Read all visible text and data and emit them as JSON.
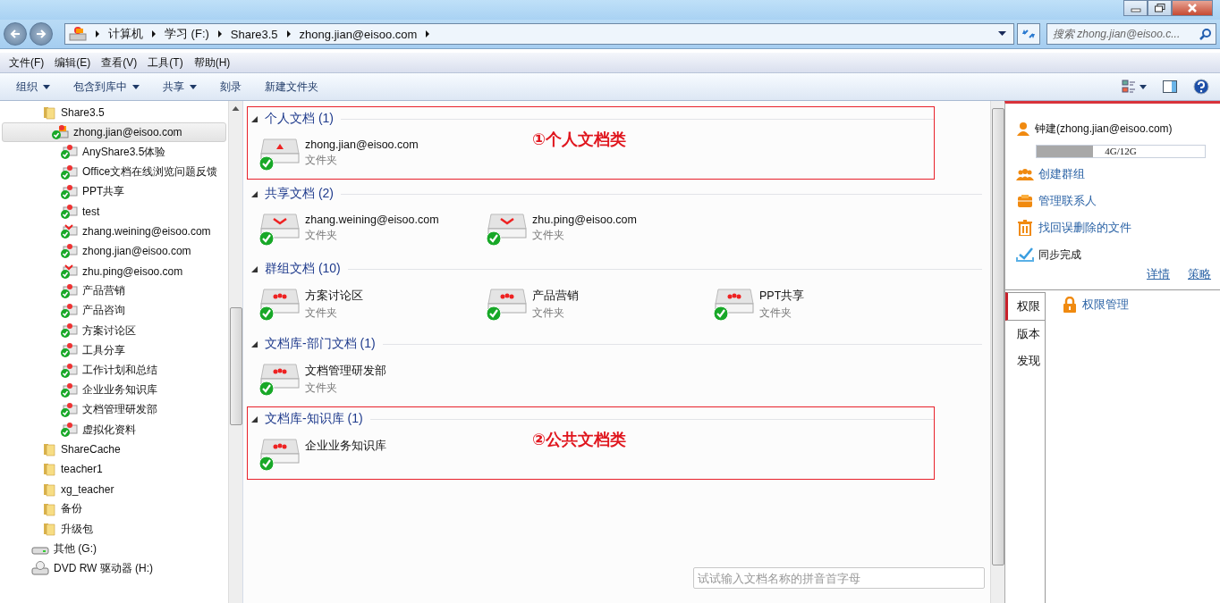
{
  "address_bar": {
    "crumbs": [
      "计算机",
      "学习 (F:)",
      "Share3.5",
      "zhong.jian@eisoo.com"
    ],
    "search": {
      "placeholder": "搜索 zhong.jian@eisoo.c..."
    }
  },
  "menu": [
    "文件(F)",
    "编辑(E)",
    "查看(V)",
    "工具(T)",
    "帮助(H)"
  ],
  "toolbar": [
    {
      "label": "组织",
      "dropdown": true
    },
    {
      "label": "包含到库中",
      "dropdown": true
    },
    {
      "label": "共享",
      "dropdown": true
    },
    {
      "label": "刻录",
      "dropdown": false
    },
    {
      "label": "新建文件夹",
      "dropdown": false
    }
  ],
  "sidebar": {
    "items": [
      {
        "label": "Share3.5",
        "kind": "folder",
        "selected": false,
        "children": [
          {
            "label": "zhong.jian@eisoo.com",
            "kind": "share-root",
            "selected": true,
            "children": [
              {
                "label": "AnyShare3.5体验",
                "kind": "group",
                "selected": false
              },
              {
                "label": "Office文档在线浏览问题反馈",
                "kind": "group",
                "selected": false
              },
              {
                "label": "PPT共享",
                "kind": "group",
                "selected": false
              },
              {
                "label": "test",
                "kind": "group",
                "selected": false
              },
              {
                "label": "zhang.weining@eisoo.com",
                "kind": "shared",
                "selected": false
              },
              {
                "label": "zhong.jian@eisoo.com",
                "kind": "personal",
                "selected": false
              },
              {
                "label": "zhu.ping@eisoo.com",
                "kind": "shared",
                "selected": false
              },
              {
                "label": "产品营销",
                "kind": "group",
                "selected": false
              },
              {
                "label": "产品咨询",
                "kind": "group",
                "selected": false
              },
              {
                "label": "方案讨论区",
                "kind": "group",
                "selected": false
              },
              {
                "label": "工具分享",
                "kind": "group",
                "selected": false
              },
              {
                "label": "工作计划和总结",
                "kind": "group",
                "selected": false
              },
              {
                "label": "企业业务知识库",
                "kind": "group",
                "selected": false
              },
              {
                "label": "文档管理研发部",
                "kind": "group",
                "selected": false
              },
              {
                "label": "虚拟化资料",
                "kind": "group",
                "selected": false
              }
            ]
          }
        ]
      },
      {
        "label": "ShareCache",
        "kind": "folder",
        "selected": false
      },
      {
        "label": "teacher1",
        "kind": "folder",
        "selected": false
      },
      {
        "label": "xg_teacher",
        "kind": "folder",
        "selected": false
      },
      {
        "label": "备份",
        "kind": "folder",
        "selected": false
      },
      {
        "label": "升级包",
        "kind": "folder",
        "selected": false
      },
      {
        "label": "其他 (G:)",
        "kind": "drive",
        "selected": false
      },
      {
        "label": "DVD RW 驱动器 (H:)",
        "kind": "dvd",
        "selected": false
      }
    ]
  },
  "groups": [
    {
      "title": "个人文档 (1)",
      "annotation": "①个人文档类",
      "items": [
        {
          "name": "zhong.jian@eisoo.com",
          "type": "文件夹",
          "kind": "personal"
        }
      ]
    },
    {
      "title": "共享文档 (2)",
      "items": [
        {
          "name": "zhang.weining@eisoo.com",
          "type": "文件夹",
          "kind": "shared"
        },
        {
          "name": "zhu.ping@eisoo.com",
          "type": "文件夹",
          "kind": "shared"
        }
      ]
    },
    {
      "title": "群组文档 (10)",
      "items": [
        {
          "name": "方案讨论区",
          "type": "文件夹",
          "kind": "group"
        },
        {
          "name": "产品营销",
          "type": "文件夹",
          "kind": "group"
        },
        {
          "name": "PPT共享",
          "type": "文件夹",
          "kind": "group"
        }
      ]
    },
    {
      "title": "文档库-部门文档 (1)",
      "items": [
        {
          "name": "文档管理研发部",
          "type": "文件夹",
          "kind": "group"
        }
      ]
    },
    {
      "title": "文档库-知识库 (1)",
      "annotation": "②公共文档类",
      "items": [
        {
          "name": "企业业务知识库",
          "kind": "group"
        }
      ]
    }
  ],
  "pinyin_search": {
    "placeholder": "试试输入文档名称的拼音首字母"
  },
  "panel": {
    "user": "钟建(zhong.jian@eisoo.com)",
    "quota": {
      "level": 0.333,
      "reading": "4G/12G"
    },
    "actions": [
      {
        "label": "创建群组",
        "kind": "group"
      },
      {
        "label": "管理联系人",
        "kind": "contacts"
      },
      {
        "label": "找回误删除的文件",
        "kind": "trash"
      }
    ],
    "sync_status": "同步完成",
    "links": [
      "详情",
      "策略"
    ],
    "tabs": [
      {
        "label": "权限",
        "selected": true
      },
      {
        "label": "版本",
        "selected": false
      },
      {
        "label": "发现",
        "selected": false
      }
    ],
    "tab_action": "权限管理"
  }
}
